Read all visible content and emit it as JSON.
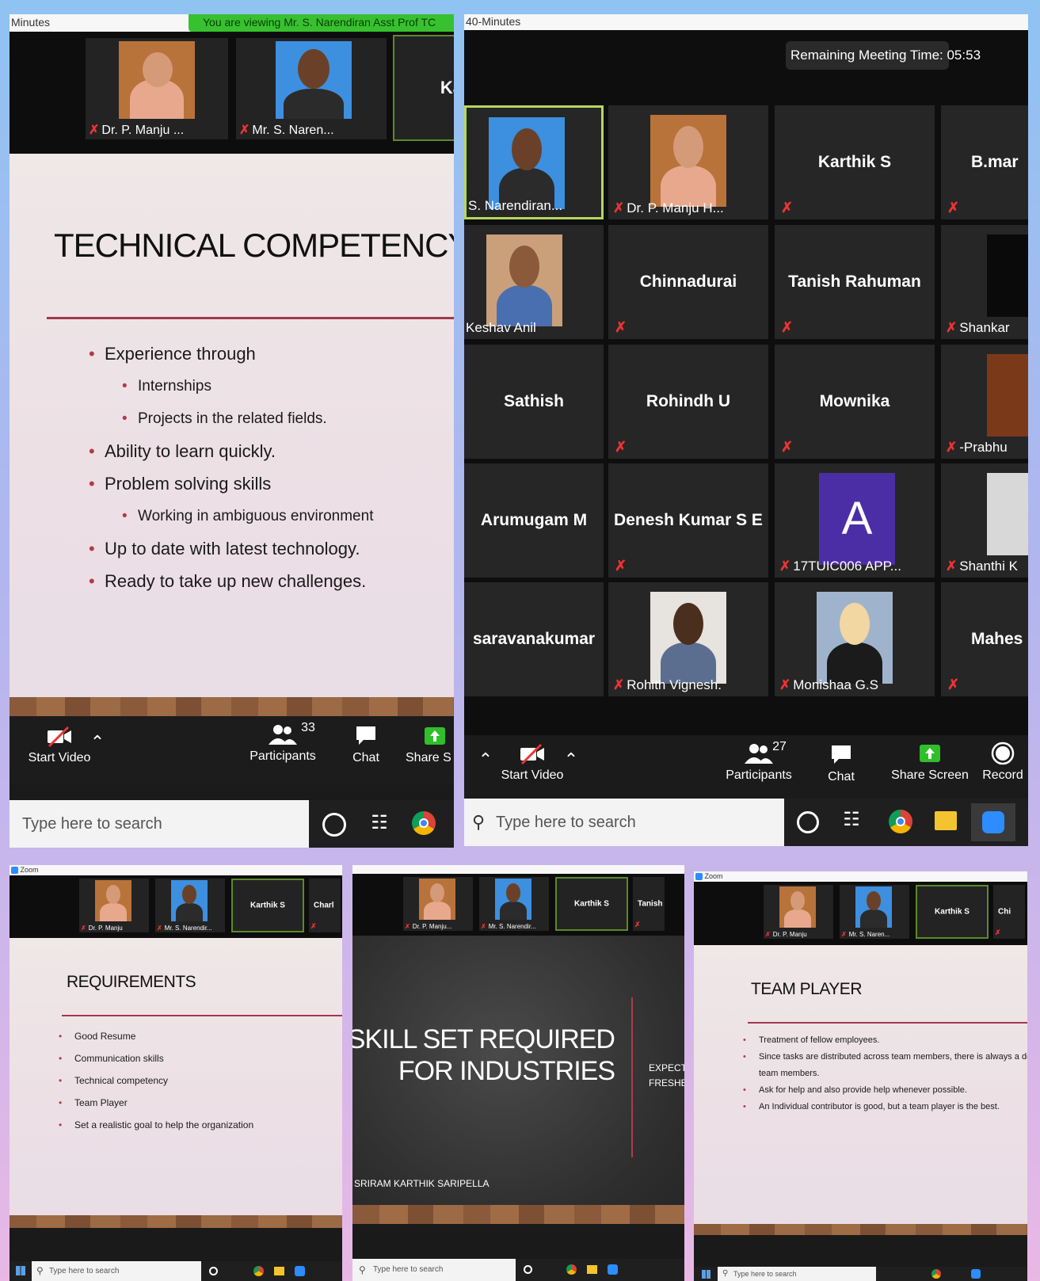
{
  "colors": {
    "zoom_bg": "#1a1a1a",
    "slide_rule": "#a0394f",
    "muted_mic": "#e33333",
    "share_green": "#2fbf2a",
    "taskbar": "#1f1f1f"
  },
  "p1": {
    "topbar_left": "Minutes",
    "green_banner": "You are viewing Mr. S. Narendiran Asst Prof TC",
    "thumbs": [
      "Dr. P. Manju ...",
      "Mr. S. Naren...",
      "Ka"
    ],
    "slide": {
      "title": "TECHNICAL COMPETENCY",
      "bullets": [
        {
          "text": "Experience through",
          "sub": false
        },
        {
          "text": "Internships",
          "sub": true
        },
        {
          "text": "Projects in the related fields.",
          "sub": true
        },
        {
          "text": "Ability to learn quickly.",
          "sub": false
        },
        {
          "text": "Problem solving skills",
          "sub": false
        },
        {
          "text": "Working in ambiguous environment",
          "sub": true
        },
        {
          "text": "Up to date with latest technology.",
          "sub": false
        },
        {
          "text": "Ready to take up new challenges.",
          "sub": false
        }
      ]
    },
    "toolbar": {
      "start_video": "Start Video",
      "participants": "Participants",
      "participants_count": "33",
      "chat": "Chat",
      "share": "Share S"
    },
    "search": "Type here to search"
  },
  "p2": {
    "topbar_left": "40-Minutes",
    "remaining": "Remaining Meeting Time: 05:53",
    "grid": [
      [
        "S. Narendiran...",
        "Dr. P. Manju H...",
        "Karthik S",
        "B.mar"
      ],
      [
        "Keshav Anil",
        "Chinnadurai",
        "Tanish Rahuman",
        "Shankar"
      ],
      [
        "Sathish",
        "Rohindh U",
        "Mownika",
        "-Prabhu"
      ],
      [
        "Arumugam M",
        "Denesh Kumar S E",
        "17TUIC006 APP...",
        "Shanthi K"
      ],
      [
        "saravanakumar",
        "Rohith Vignesh.",
        "Monishaa G.S",
        "Mahes"
      ]
    ],
    "avatar_letter": "A",
    "toolbar": {
      "start_video": "Start Video",
      "participants": "Participants",
      "participants_count": "27",
      "chat": "Chat",
      "share": "Share Screen",
      "record": "Record"
    },
    "search": "Type here to search"
  },
  "p3": {
    "app": "Zoom",
    "thumbs": [
      "Dr. P. Manju",
      "Mr. S. Narendir...",
      "Karthik S",
      "Charl"
    ],
    "slide": {
      "title": "REQUIREMENTS",
      "bullets": [
        "Good Resume",
        "Communication skills",
        "Technical competency",
        "Team Player",
        "Set a realistic goal to help the organization"
      ]
    },
    "search": "Type here to search"
  },
  "p4": {
    "thumbs": [
      "Dr. P. Manju...",
      "Mr. S. Narendir...",
      "Karthik S",
      "Tanish Rahu"
    ],
    "slide": {
      "title_line1": "SKILL SET REQUIRED",
      "title_line2": "FOR INDUSTRIES",
      "side_line1": "EXPECTA",
      "side_line2": "FRESHER",
      "author": "SRIRAM KARTHIK SARIPELLA"
    },
    "search": "Type here to search"
  },
  "p5": {
    "app": "Zoom",
    "thumbs": [
      "Dr. P. Manju",
      "Mr. S. Naren...",
      "Karthik S",
      "Chi"
    ],
    "slide": {
      "title": "TEAM PLAYER",
      "bullets": [
        "Treatment of fellow employees.",
        "Since tasks are distributed across team members, there is always a dep",
        "team members.",
        "Ask for help and also provide help whenever possible.",
        "An Individual contributor is good, but a team player is the best."
      ]
    },
    "search": "Type here to search"
  }
}
